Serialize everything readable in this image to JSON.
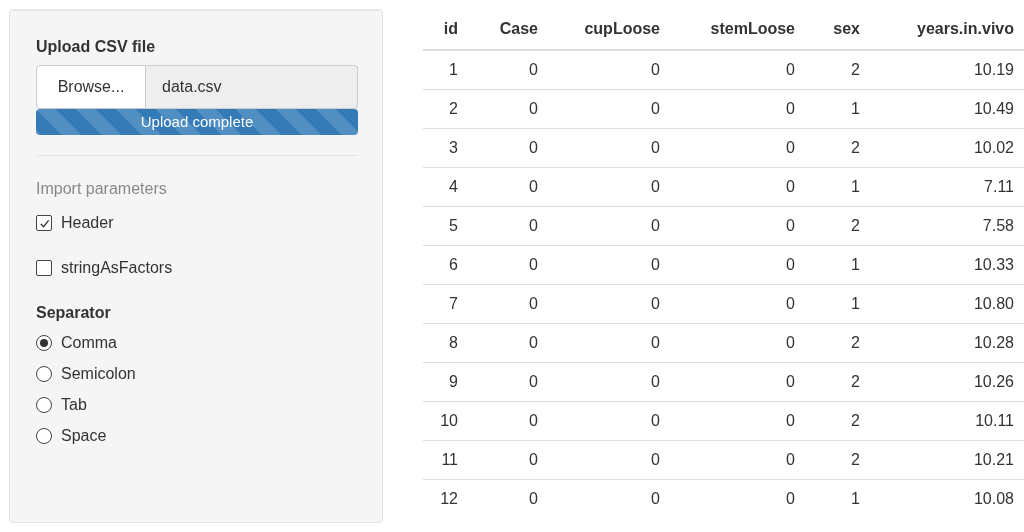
{
  "sidebar": {
    "upload": {
      "label": "Upload CSV file",
      "button": "Browse...",
      "filename": "data.csv",
      "progress": {
        "level": 1,
        "text": "Upload complete"
      }
    },
    "import_heading": "Import parameters",
    "checkboxes": [
      {
        "label": "Header",
        "checked": true
      },
      {
        "label": "stringAsFactors",
        "checked": false
      }
    ],
    "separator": {
      "label": "Separator",
      "options": [
        {
          "label": "Comma",
          "selected": true
        },
        {
          "label": "Semicolon",
          "selected": false
        },
        {
          "label": "Tab",
          "selected": false
        },
        {
          "label": "Space",
          "selected": false
        }
      ]
    }
  },
  "table": {
    "columns": [
      "id",
      "Case",
      "cupLoose",
      "stemLoose",
      "sex",
      "years.in.vivo"
    ],
    "rows": [
      [
        "1",
        "0",
        "0",
        "0",
        "2",
        "10.19"
      ],
      [
        "2",
        "0",
        "0",
        "0",
        "1",
        "10.49"
      ],
      [
        "3",
        "0",
        "0",
        "0",
        "2",
        "10.02"
      ],
      [
        "4",
        "0",
        "0",
        "0",
        "1",
        "7.11"
      ],
      [
        "5",
        "0",
        "0",
        "0",
        "2",
        "7.58"
      ],
      [
        "6",
        "0",
        "0",
        "0",
        "1",
        "10.33"
      ],
      [
        "7",
        "0",
        "0",
        "0",
        "1",
        "10.80"
      ],
      [
        "8",
        "0",
        "0",
        "0",
        "2",
        "10.28"
      ],
      [
        "9",
        "0",
        "0",
        "0",
        "2",
        "10.26"
      ],
      [
        "10",
        "0",
        "0",
        "0",
        "2",
        "10.11"
      ],
      [
        "11",
        "0",
        "0",
        "0",
        "2",
        "10.21"
      ],
      [
        "12",
        "0",
        "0",
        "0",
        "1",
        "10.08"
      ]
    ]
  }
}
